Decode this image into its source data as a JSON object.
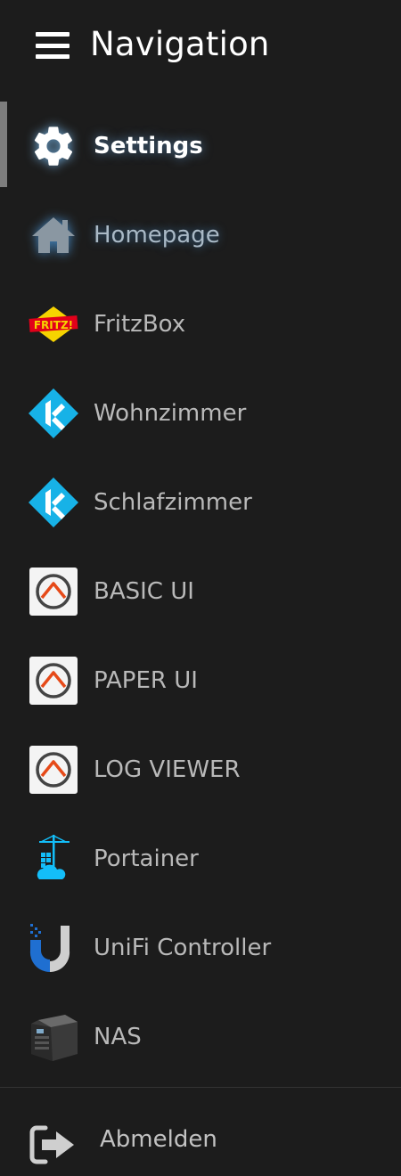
{
  "header": {
    "title": "Navigation",
    "menu_icon": "hamburger-menu-icon"
  },
  "nav": [
    {
      "label": "Settings",
      "icon": "gear-icon",
      "active": true
    },
    {
      "label": "Homepage",
      "icon": "home-icon"
    },
    {
      "label": "FritzBox",
      "icon": "fritzbox-logo-icon",
      "logo_text": "FRITZ!"
    },
    {
      "label": "Wohnzimmer",
      "icon": "kodi-icon"
    },
    {
      "label": "Schlafzimmer",
      "icon": "kodi-icon"
    },
    {
      "label": "BASIC UI",
      "icon": "openhab-icon"
    },
    {
      "label": "PAPER UI",
      "icon": "openhab-icon"
    },
    {
      "label": "LOG VIEWER",
      "icon": "openhab-icon"
    },
    {
      "label": "Portainer",
      "icon": "portainer-icon"
    },
    {
      "label": "UniFi Controller",
      "icon": "unifi-icon"
    },
    {
      "label": "NAS",
      "icon": "nas-device-icon"
    }
  ],
  "logout": {
    "label": "Abmelden",
    "icon": "logout-icon"
  },
  "colors": {
    "background": "#1c1c1c",
    "text": "#b9b9b9",
    "active_text": "#ffffff",
    "kodi_blue": "#17b2e7",
    "openhab_orange": "#e64a19",
    "portainer_blue": "#13bef9",
    "unifi_blue": "#1f6fd1"
  }
}
